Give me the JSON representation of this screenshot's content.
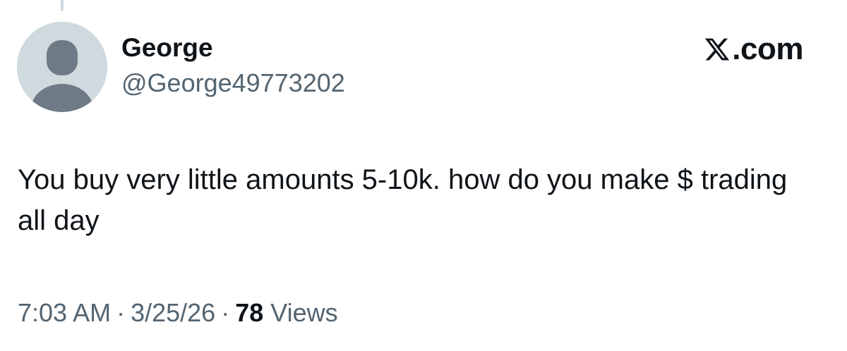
{
  "author": {
    "display_name": "George",
    "handle": "@George49773202"
  },
  "brand": {
    "icon": "x-logo-icon",
    "suffix": ".com"
  },
  "tweet": {
    "text": "You buy very little amounts 5-10k. how do you make $ trading all day"
  },
  "meta": {
    "time": "7:03 AM",
    "separator": "·",
    "date": "3/25/26",
    "views_count": "78",
    "views_label": "Views"
  },
  "colors": {
    "text_primary": "#0f1419",
    "text_secondary": "#536471",
    "avatar_bg": "#cfd9de",
    "avatar_silhouette": "#6e7b86"
  }
}
